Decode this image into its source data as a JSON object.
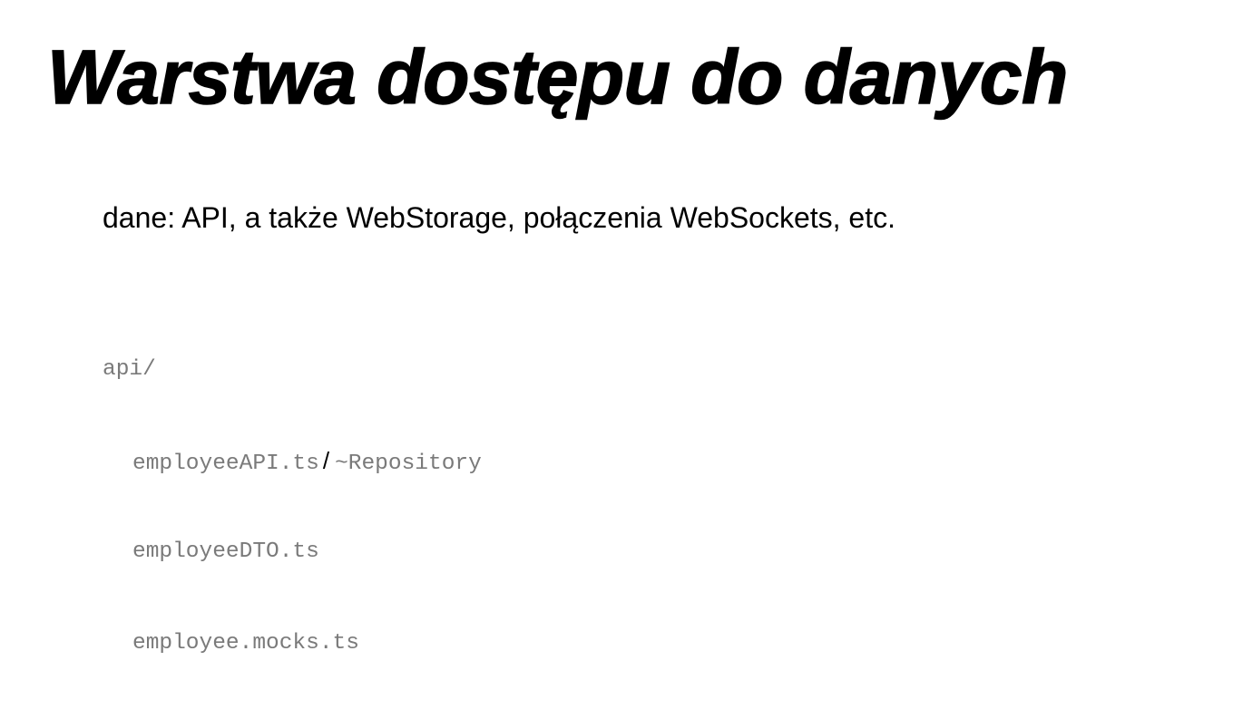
{
  "slide": {
    "title": "Warstwa dostępu do danych",
    "subtitle": "dane: API, a także WebStorage, połączenia WebSockets, etc.",
    "tree": {
      "folder": "api/",
      "files": [
        {
          "name": "employeeAPI.ts",
          "separator": "/",
          "alias": "~Repository"
        },
        {
          "name": "employeeDTO.ts"
        },
        {
          "name": "employee.mocks.ts"
        }
      ]
    }
  },
  "colors": {
    "background": "#ffffff",
    "title": "#000000",
    "subtitle": "#000000",
    "code": "#7a7a7a",
    "separator": "#000000"
  }
}
